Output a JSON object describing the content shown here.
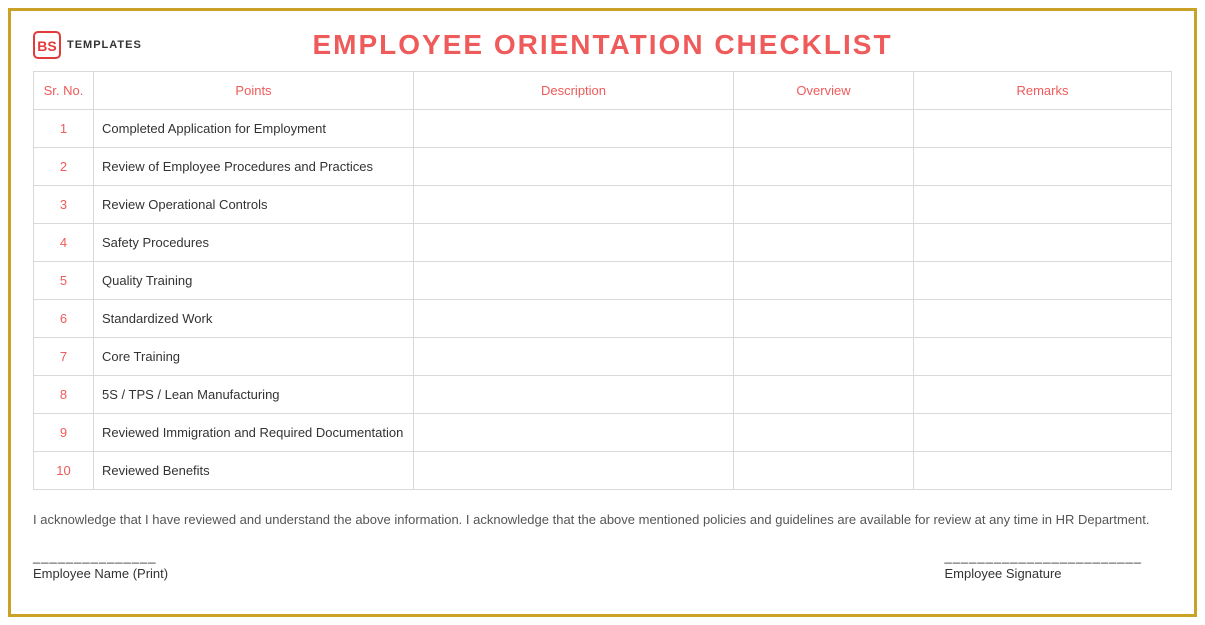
{
  "logo": {
    "text": "TEMPLATES"
  },
  "title": "EMPLOYEE ORIENTATION CHECKLIST",
  "columns": {
    "sr": "Sr. No.",
    "points": "Points",
    "description": "Description",
    "overview": "Overview",
    "remarks": "Remarks"
  },
  "rows": [
    {
      "sr": "1",
      "points": "Completed Application for Employment",
      "description": "",
      "overview": "",
      "remarks": ""
    },
    {
      "sr": "2",
      "points": "Review of Employee Procedures and Practices",
      "description": "",
      "overview": "",
      "remarks": ""
    },
    {
      "sr": "3",
      "points": " Review Operational Controls",
      "description": "",
      "overview": "",
      "remarks": ""
    },
    {
      "sr": "4",
      "points": "Safety Procedures",
      "description": "",
      "overview": "",
      "remarks": ""
    },
    {
      "sr": "5",
      "points": "Quality Training",
      "description": "",
      "overview": "",
      "remarks": ""
    },
    {
      "sr": "6",
      "points": "Standardized Work",
      "description": "",
      "overview": "",
      "remarks": ""
    },
    {
      "sr": "7",
      "points": "Core Training",
      "description": "",
      "overview": "",
      "remarks": ""
    },
    {
      "sr": "8",
      "points": "5S / TPS / Lean Manufacturing",
      "description": "",
      "overview": "",
      "remarks": ""
    },
    {
      "sr": "9",
      "points": "Reviewed Immigration and Required Documentation",
      "description": "",
      "overview": "",
      "remarks": ""
    },
    {
      "sr": "10",
      "points": "Reviewed Benefits",
      "description": "",
      "overview": "",
      "remarks": ""
    }
  ],
  "acknowledgement": "I acknowledge that I have reviewed and understand the above information.  I acknowledge that the above mentioned policies and guidelines are available for review at any time in HR Department.",
  "signature": {
    "line": "_______________",
    "name_label": "Employee Name (Print)",
    "sig_line": "________________________",
    "sig_label": "Employee Signature"
  }
}
